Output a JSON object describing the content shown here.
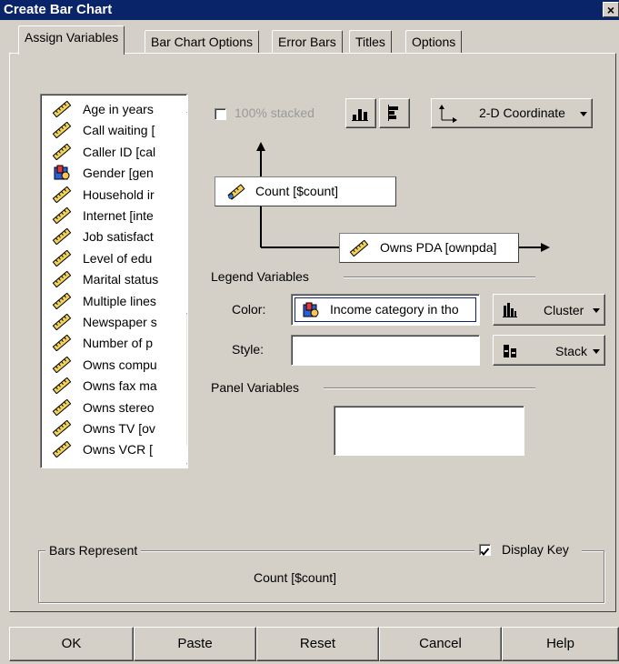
{
  "window": {
    "title": "Create Bar Chart",
    "close_label": "×"
  },
  "tabs": [
    {
      "label": "Assign Variables",
      "active": true
    },
    {
      "label": "Bar Chart Options",
      "active": false
    },
    {
      "label": "Error Bars",
      "active": false
    },
    {
      "label": "Titles",
      "active": false
    },
    {
      "label": "Options",
      "active": false
    }
  ],
  "variables": [
    {
      "label": "Age in years",
      "icon": "ruler-icon"
    },
    {
      "label": "Call waiting [",
      "icon": "ruler-icon"
    },
    {
      "label": "Caller ID [cal",
      "icon": "ruler-icon"
    },
    {
      "label": "Gender [gen",
      "icon": "nominal-icon"
    },
    {
      "label": "Household ir",
      "icon": "ruler-icon"
    },
    {
      "label": "Internet [inte",
      "icon": "ruler-icon"
    },
    {
      "label": "Job satisfact",
      "icon": "ruler-icon"
    },
    {
      "label": "Level of edu",
      "icon": "ruler-icon"
    },
    {
      "label": "Marital status",
      "icon": "ruler-icon"
    },
    {
      "label": "Multiple lines",
      "icon": "ruler-icon"
    },
    {
      "label": "Newspaper s",
      "icon": "ruler-icon"
    },
    {
      "label": "Number of p",
      "icon": "ruler-icon"
    },
    {
      "label": "Owns compu",
      "icon": "ruler-icon"
    },
    {
      "label": "Owns fax ma",
      "icon": "ruler-icon"
    },
    {
      "label": "Owns stereo",
      "icon": "ruler-icon"
    },
    {
      "label": "Owns TV [ov",
      "icon": "ruler-icon"
    },
    {
      "label": "Owns VCR [",
      "icon": "ruler-icon"
    }
  ],
  "options": {
    "stacked_label": "100% stacked",
    "stacked_checked": false,
    "coordinate_label": "2-D Coordinate"
  },
  "axes": {
    "y_variable": "Count [$count]",
    "x_variable": "Owns PDA [ownpda]"
  },
  "legend": {
    "section_label": "Legend Variables",
    "color_label": "Color:",
    "color_value": "Income category in tho",
    "style_label": "Style:",
    "style_value": "",
    "cluster_label": "Cluster",
    "stack_label": "Stack"
  },
  "panel": {
    "section_label": "Panel Variables",
    "value": ""
  },
  "bars_represent": {
    "section_label": "Bars Represent",
    "display_key_label": "Display Key",
    "display_key_checked": true,
    "value": "Count [$count]"
  },
  "buttons": {
    "ok": "OK",
    "paste": "Paste",
    "reset": "Reset",
    "cancel": "Cancel",
    "help": "Help"
  },
  "colors": {
    "titlebar": "#0a246a",
    "dialog_bg": "#d4d0c8",
    "selection_border": "#0a246a"
  }
}
